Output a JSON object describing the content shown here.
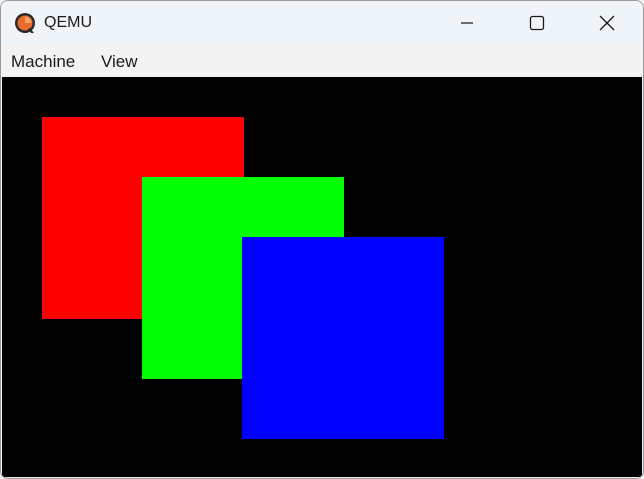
{
  "window": {
    "title": "QEMU",
    "icon": "qemu-logo-icon",
    "controls": {
      "minimize_icon": "minimize-icon",
      "maximize_icon": "maximize-icon",
      "close_icon": "close-icon"
    }
  },
  "menubar": {
    "items": [
      {
        "label": "Machine"
      },
      {
        "label": "View"
      }
    ]
  },
  "screen": {
    "background": "#000000",
    "shapes": [
      {
        "name": "red-square",
        "color": "#ff0000"
      },
      {
        "name": "green-square",
        "color": "#00ff00"
      },
      {
        "name": "blue-square",
        "color": "#0000ff"
      }
    ]
  }
}
